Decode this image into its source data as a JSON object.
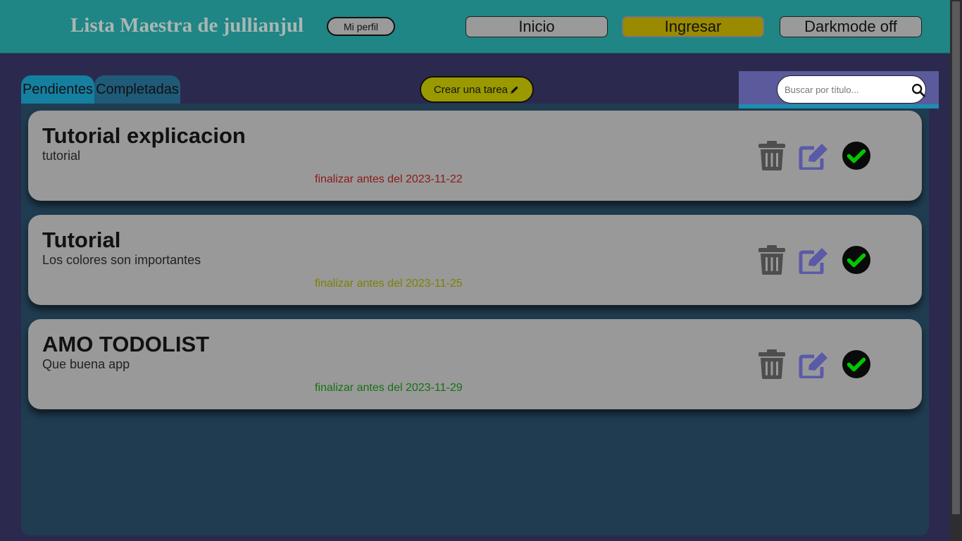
{
  "header": {
    "app_title": "Lista Maestra de jullianjul",
    "profile_label": "Mi perfil",
    "nav": [
      {
        "label": "Inicio",
        "active": false
      },
      {
        "label": "Ingresar",
        "active": true
      },
      {
        "label": "Darkmode off",
        "active": false
      }
    ]
  },
  "tabs": [
    {
      "label": "Pendientes",
      "selected": true
    },
    {
      "label": "Completadas",
      "selected": false
    }
  ],
  "create_task_label": "Crear una tarea",
  "search": {
    "placeholder": "Buscar por título...",
    "value": ""
  },
  "tasks": [
    {
      "title": "Tutorial explicacion",
      "description": "tutorial",
      "due_text": "finalizar antes del 2023-11-22",
      "due_color": "#8b1a1a"
    },
    {
      "title": "Tutorial",
      "description": "Los colores son importantes",
      "due_text": "finalizar antes del 2023-11-25",
      "due_color": "#7f7f00"
    },
    {
      "title": "AMO TODOLIST",
      "description": "Que buena app",
      "due_text": "finalizar antes del 2023-11-29",
      "due_color": "#167016"
    }
  ],
  "task_actions": {
    "delete_icon": "trash-icon",
    "edit_icon": "edit-icon",
    "complete_icon": "check-circle-icon"
  },
  "colors": {
    "header_bg": "#1f8585",
    "page_bg": "#2b2a4e",
    "panel_bg": "#203c51",
    "card_bg": "#999999",
    "accent_yellow": "#9a8a00",
    "edit_icon": "#5a5aa8",
    "check_green": "#00c800"
  }
}
